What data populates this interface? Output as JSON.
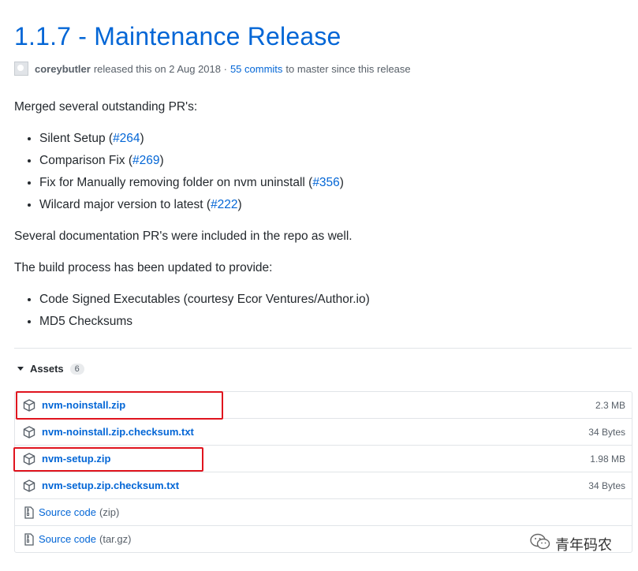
{
  "release": {
    "title": "1.1.7 - Maintenance Release",
    "author": "coreybutler",
    "released_text": "released this on 2 Aug 2018 ·",
    "commits_link": "55 commits",
    "commits_suffix": "to master since this release"
  },
  "notes": {
    "intro": "Merged several outstanding PR's:",
    "pr_items": [
      {
        "text": "Silent Setup (",
        "link": "#264",
        "after": ")"
      },
      {
        "text": "Comparison Fix (",
        "link": "#269",
        "after": ")"
      },
      {
        "text": "Fix for Manually removing folder on nvm uninstall (",
        "link": "#356",
        "after": ")"
      },
      {
        "text": "Wilcard major version to latest (",
        "link": "#222",
        "after": ")"
      }
    ],
    "docs": "Several documentation PR's were included in the repo as well.",
    "build_intro": "The build process has been updated to provide:",
    "build_items": [
      "Code Signed Executables (courtesy Ecor Ventures/Author.io)",
      "MD5 Checksums"
    ]
  },
  "assets": {
    "label": "Assets",
    "count": "6",
    "files": [
      {
        "name": "nvm-noinstall.zip",
        "size": "2.3 MB"
      },
      {
        "name": "nvm-noinstall.zip.checksum.txt",
        "size": "34 Bytes"
      },
      {
        "name": "nvm-setup.zip",
        "size": "1.98 MB"
      },
      {
        "name": "nvm-setup.zip.checksum.txt",
        "size": "34 Bytes"
      }
    ],
    "sources": [
      {
        "name": "Source code",
        "format": "(zip)"
      },
      {
        "name": "Source code",
        "format": "(tar.gz)"
      }
    ]
  },
  "watermark": {
    "text": "青年码农"
  },
  "colors": {
    "link": "#0366d6",
    "highlight": "#e0141e",
    "text": "#24292e",
    "muted": "#586069"
  }
}
